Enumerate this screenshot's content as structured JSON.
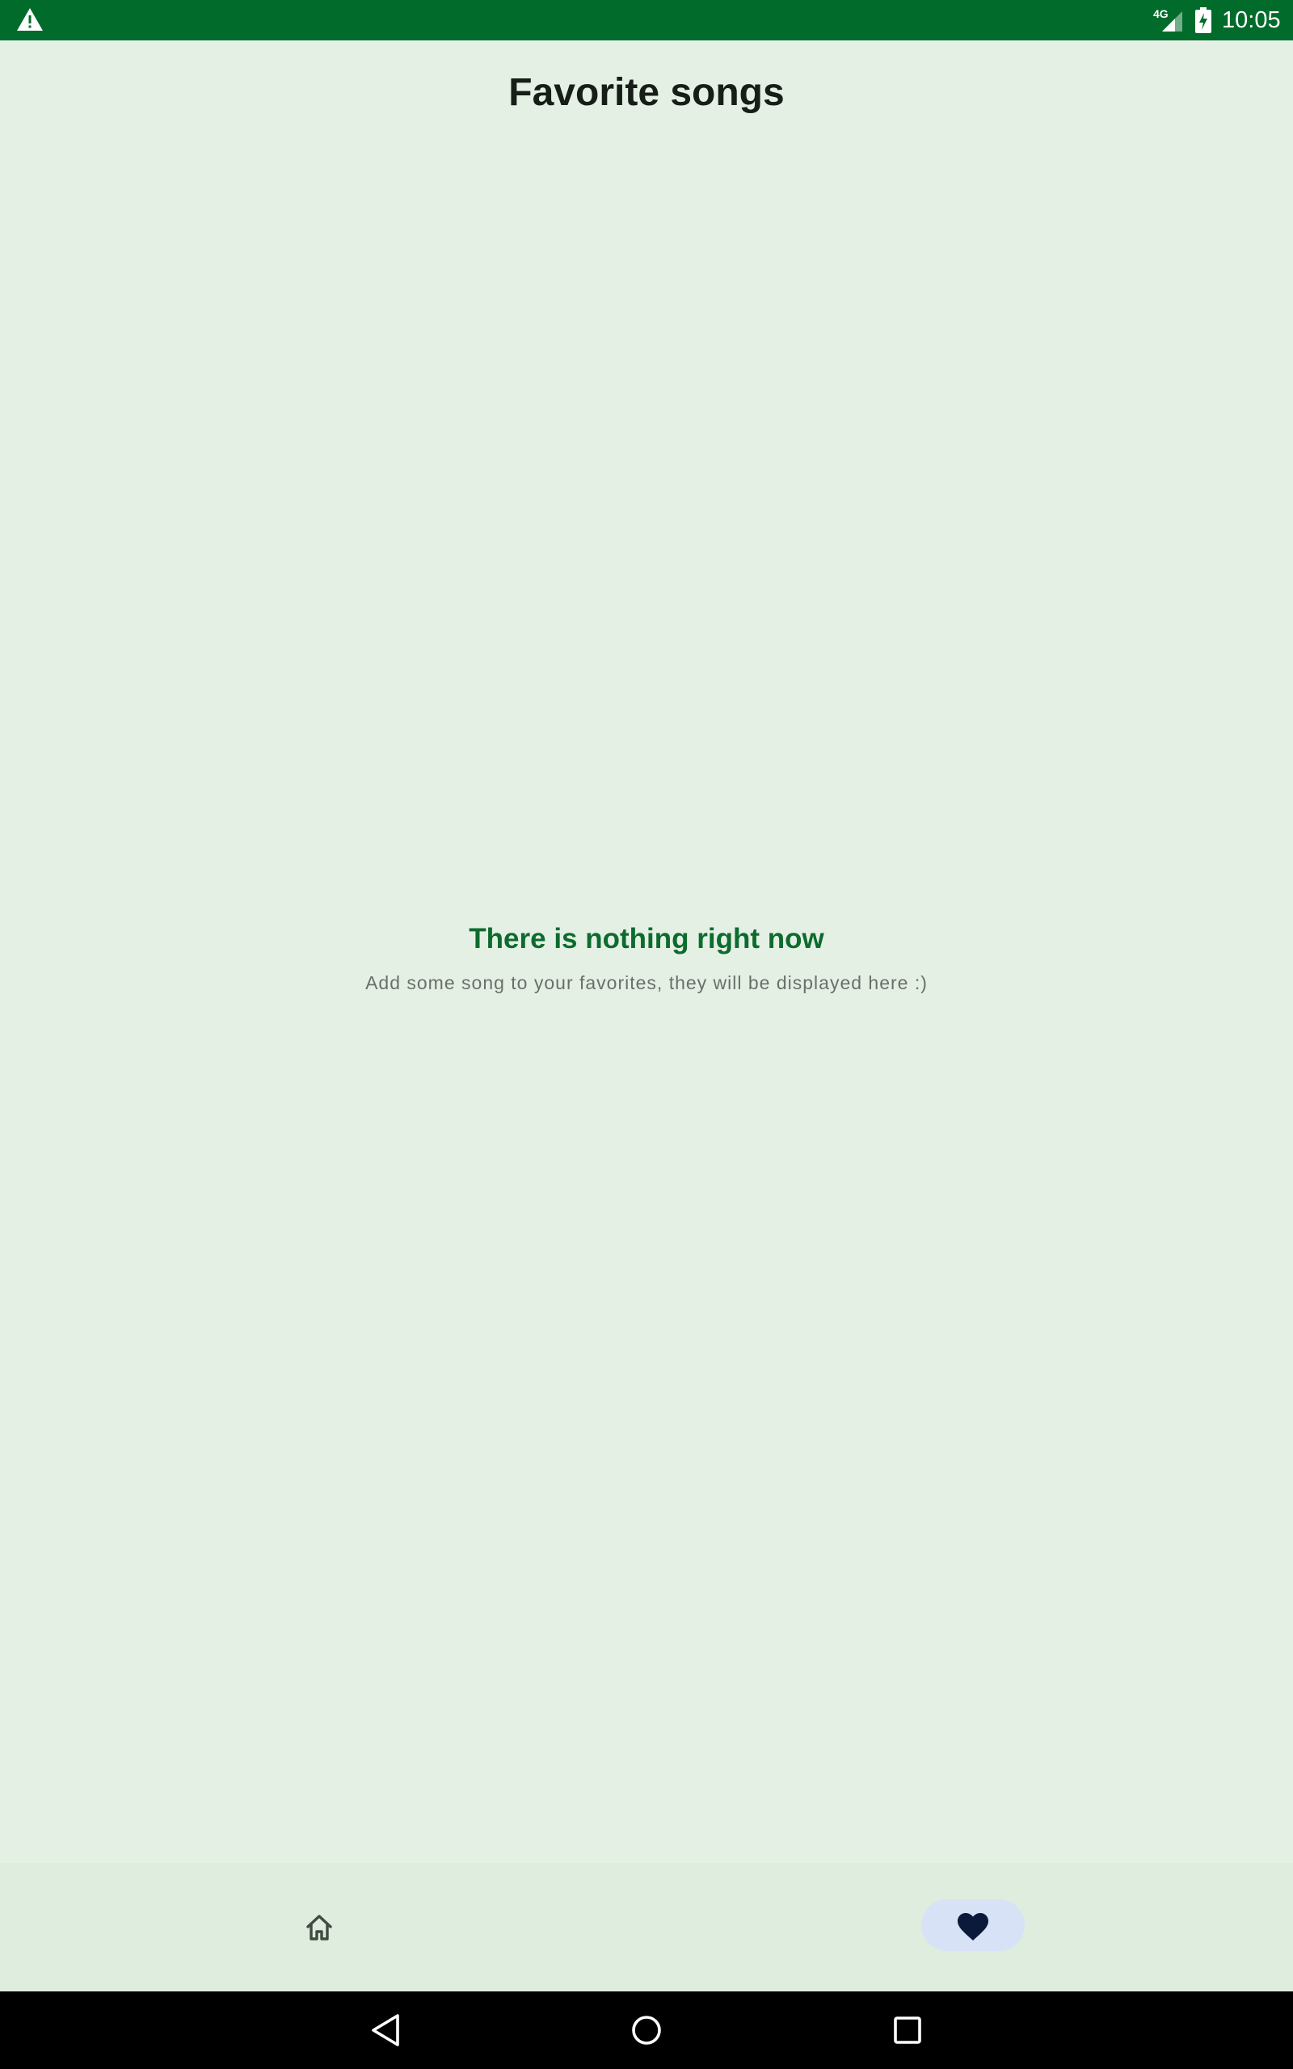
{
  "status_bar": {
    "network": "4G",
    "time": "10:05",
    "icons": [
      "warning-icon",
      "signal-icon",
      "battery-charging-icon"
    ]
  },
  "header": {
    "title": "Favorite songs"
  },
  "empty_state": {
    "title": "There is nothing right now",
    "subtitle": "Add some song to your favorites, they will be displayed here :)"
  },
  "bottom_nav": {
    "items": [
      {
        "icon": "home-icon",
        "selected": false
      },
      {
        "icon": "heart-icon",
        "selected": true
      }
    ]
  },
  "system_nav": {
    "buttons": [
      "back-icon",
      "home-circle-icon",
      "recents-icon"
    ]
  },
  "colors": {
    "status_bar": "#006b2b",
    "background": "#e5f0e5",
    "accent_text": "#0d6b2e",
    "nav_indicator": "#d8e2f7",
    "heart": "#0b1a3b"
  }
}
